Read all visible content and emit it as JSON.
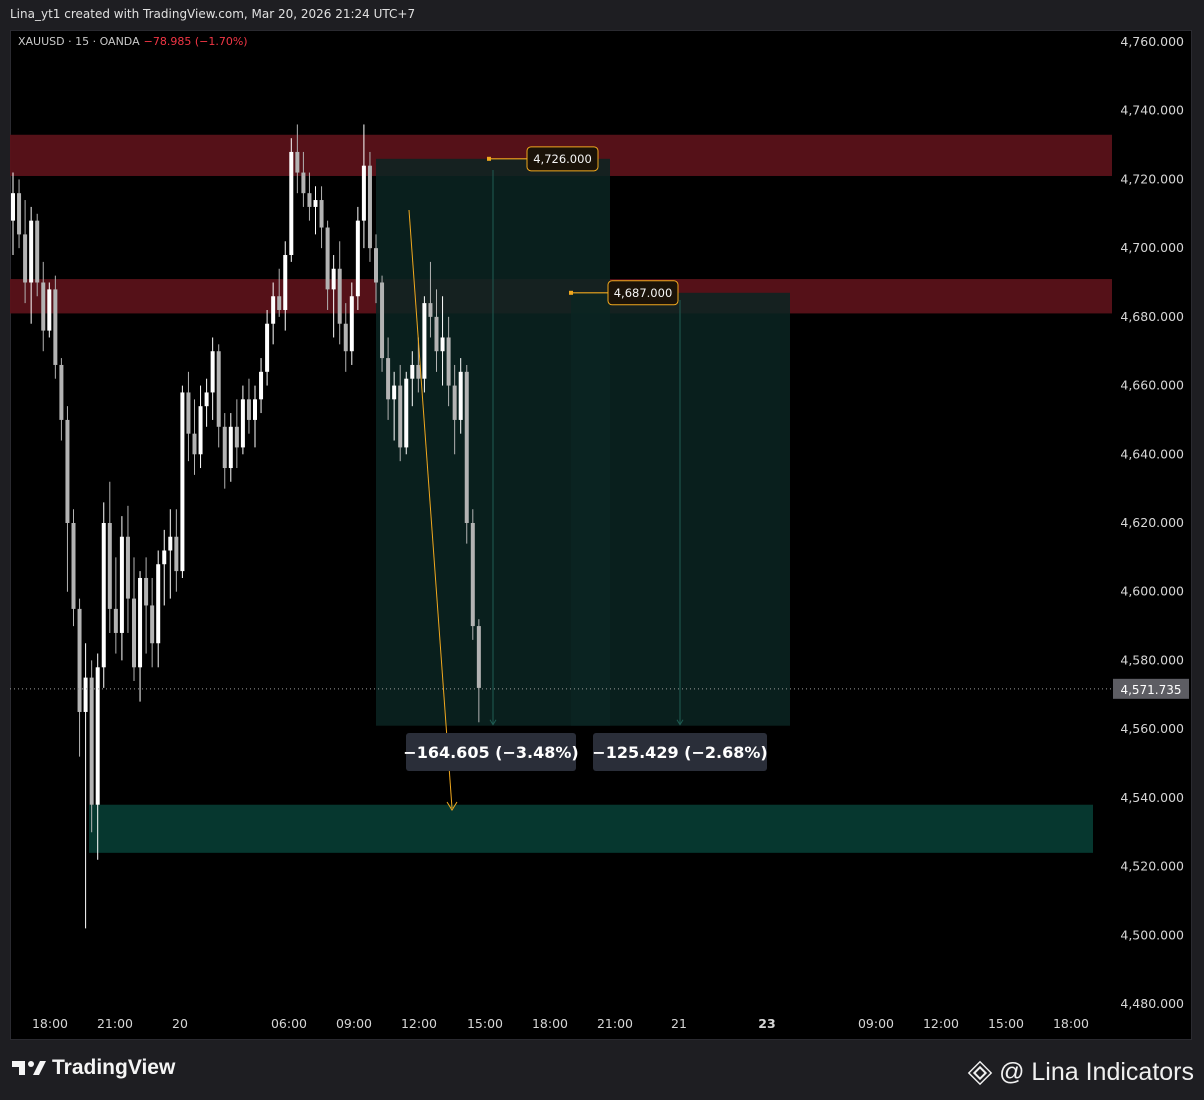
{
  "header": {
    "credit": "Lina_yt1 created with TradingView.com, Mar 20, 2026 21:24 UTC+7"
  },
  "legend": {
    "symbol": "XAUUSD · 15 · OANDA",
    "change": "−78.985 (−1.70%)"
  },
  "footer": {
    "logo_text": "TradingView",
    "brand": "@ Lina Indicators"
  },
  "colors": {
    "up": "#ffffff",
    "down": "#b3b3b3",
    "resistance_zone": "#5a1219",
    "target_zone": "#063a31",
    "position_box": "#0b2522",
    "accent": "#f0a81e"
  },
  "chart_data": {
    "type": "candlestick",
    "ylim": [
      4480,
      4760
    ],
    "y_ticks": [
      "4,760.000",
      "4,740.000",
      "4,720.000",
      "4,700.000",
      "4,680.000",
      "4,660.000",
      "4,640.000",
      "4,620.000",
      "4,600.000",
      "4,580.000",
      "4,560.000",
      "4,540.000",
      "4,520.000",
      "4,500.000",
      "4,480.000"
    ],
    "y_tick_values": [
      4760,
      4740,
      4720,
      4700,
      4680,
      4660,
      4640,
      4620,
      4600,
      4580,
      4560,
      4540,
      4520,
      4500,
      4480
    ],
    "x_ticks": [
      "18:00",
      "21:00",
      "20",
      "06:00",
      "09:00",
      "12:00",
      "15:00",
      "18:00",
      "21:00",
      "21",
      "23",
      "09:00",
      "12:00",
      "15:00",
      "18:00"
    ],
    "last_price": 4571.735,
    "last_price_label": "4,571.735",
    "zones": [
      {
        "name": "resistance-zone-upper",
        "low": 4721,
        "high": 4733
      },
      {
        "name": "resistance-zone-lower",
        "low": 4681,
        "high": 4691
      },
      {
        "name": "target-zone",
        "low": 4524,
        "high": 4538
      }
    ],
    "entries": [
      {
        "price": 4726,
        "label": "4,726.000",
        "result": "−164.605 (−3.48%)"
      },
      {
        "price": 4687,
        "label": "4,687.000",
        "result": "−125.429 (−2.68%)"
      }
    ],
    "candles": [
      [
        4708,
        4722,
        4698,
        4716
      ],
      [
        4716,
        4720,
        4700,
        4704
      ],
      [
        4704,
        4714,
        4684,
        4690
      ],
      [
        4690,
        4712,
        4678,
        4708
      ],
      [
        4708,
        4710,
        4686,
        4690
      ],
      [
        4690,
        4696,
        4670,
        4676
      ],
      [
        4676,
        4690,
        4674,
        4688
      ],
      [
        4688,
        4692,
        4662,
        4666
      ],
      [
        4666,
        4668,
        4644,
        4650
      ],
      [
        4650,
        4654,
        4600,
        4620
      ],
      [
        4620,
        4624,
        4590,
        4595
      ],
      [
        4595,
        4598,
        4552,
        4565
      ],
      [
        4565,
        4585,
        4502,
        4575
      ],
      [
        4575,
        4580,
        4530,
        4538
      ],
      [
        4538,
        4582,
        4522,
        4578
      ],
      [
        4578,
        4626,
        4572,
        4620
      ],
      [
        4620,
        4632,
        4588,
        4595
      ],
      [
        4595,
        4610,
        4582,
        4588
      ],
      [
        4588,
        4622,
        4580,
        4616
      ],
      [
        4616,
        4625,
        4588,
        4598
      ],
      [
        4598,
        4610,
        4574,
        4578
      ],
      [
        4578,
        4606,
        4568,
        4604
      ],
      [
        4604,
        4610,
        4582,
        4596
      ],
      [
        4596,
        4604,
        4578,
        4585
      ],
      [
        4585,
        4612,
        4578,
        4608
      ],
      [
        4608,
        4618,
        4596,
        4612
      ],
      [
        4612,
        4624,
        4598,
        4616
      ],
      [
        4616,
        4624,
        4600,
        4606
      ],
      [
        4606,
        4660,
        4604,
        4658
      ],
      [
        4658,
        4664,
        4638,
        4646
      ],
      [
        4646,
        4656,
        4634,
        4640
      ],
      [
        4640,
        4660,
        4636,
        4654
      ],
      [
        4654,
        4662,
        4648,
        4658
      ],
      [
        4658,
        4674,
        4650,
        4670
      ],
      [
        4670,
        4672,
        4642,
        4648
      ],
      [
        4648,
        4652,
        4630,
        4636
      ],
      [
        4636,
        4652,
        4632,
        4648
      ],
      [
        4648,
        4656,
        4636,
        4642
      ],
      [
        4642,
        4660,
        4640,
        4656
      ],
      [
        4656,
        4662,
        4646,
        4650
      ],
      [
        4650,
        4660,
        4642,
        4656
      ],
      [
        4656,
        4668,
        4652,
        4664
      ],
      [
        4664,
        4682,
        4660,
        4678
      ],
      [
        4678,
        4690,
        4672,
        4686
      ],
      [
        4686,
        4694,
        4680,
        4682
      ],
      [
        4682,
        4702,
        4676,
        4698
      ],
      [
        4698,
        4732,
        4696,
        4728
      ],
      [
        4728,
        4736,
        4716,
        4722
      ],
      [
        4722,
        4728,
        4712,
        4716
      ],
      [
        4716,
        4722,
        4708,
        4712
      ],
      [
        4712,
        4718,
        4704,
        4714
      ],
      [
        4714,
        4718,
        4700,
        4706
      ],
      [
        4706,
        4708,
        4682,
        4688
      ],
      [
        4688,
        4698,
        4674,
        4694
      ],
      [
        4694,
        4702,
        4672,
        4678
      ],
      [
        4678,
        4684,
        4664,
        4670
      ],
      [
        4670,
        4690,
        4666,
        4686
      ],
      [
        4686,
        4712,
        4682,
        4708
      ],
      [
        4708,
        4736,
        4700,
        4724
      ],
      [
        4724,
        4728,
        4696,
        4700
      ],
      [
        4700,
        4704,
        4684,
        4690
      ],
      [
        4690,
        4692,
        4664,
        4668
      ],
      [
        4668,
        4674,
        4650,
        4656
      ],
      [
        4656,
        4664,
        4644,
        4660
      ],
      [
        4660,
        4666,
        4638,
        4642
      ],
      [
        4642,
        4664,
        4640,
        4662
      ],
      [
        4662,
        4670,
        4654,
        4666
      ],
      [
        4666,
        4674,
        4658,
        4662
      ],
      [
        4662,
        4686,
        4658,
        4684
      ],
      [
        4684,
        4696,
        4674,
        4680
      ],
      [
        4680,
        4688,
        4664,
        4670
      ],
      [
        4670,
        4686,
        4660,
        4674
      ],
      [
        4674,
        4680,
        4654,
        4660
      ],
      [
        4660,
        4666,
        4640,
        4650
      ],
      [
        4650,
        4668,
        4646,
        4664
      ],
      [
        4664,
        4666,
        4614,
        4620
      ],
      [
        4620,
        4624,
        4586,
        4590
      ],
      [
        4590,
        4592,
        4562,
        4572
      ]
    ]
  }
}
